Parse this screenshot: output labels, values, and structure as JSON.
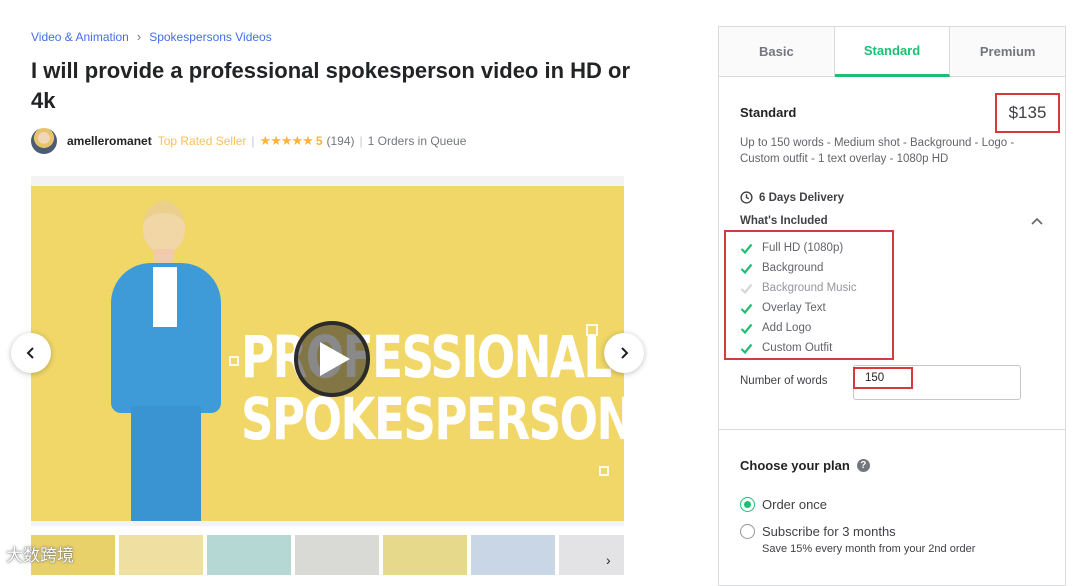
{
  "breadcrumb": {
    "category": "Video & Animation",
    "subcategory": "Spokespersons Videos"
  },
  "gig": {
    "title": "I will provide a professional spokesperson video in HD or 4k"
  },
  "seller": {
    "name": "amelleromanet",
    "level": "Top Rated Seller",
    "rating": "5",
    "reviews": "(194)",
    "queue": "1 Orders in Queue"
  },
  "gallery": {
    "promo_line1": "PROFESSIONAL",
    "promo_line2": "SPOKESPERSON"
  },
  "watermark": "大数跨境",
  "packages": {
    "tabs": [
      "Basic",
      "Standard",
      "Premium"
    ],
    "active_tab": "Standard",
    "name": "Standard",
    "price": "$135",
    "description": "Up to 150 words - Medium shot - Background - Logo - Custom outfit - 1 text overlay - 1080p HD",
    "delivery": "6 Days Delivery",
    "included_title": "What's Included",
    "features": [
      {
        "label": "Full HD (1080p)",
        "included": true
      },
      {
        "label": "Background",
        "included": true
      },
      {
        "label": "Background Music",
        "included": false
      },
      {
        "label": "Overlay Text",
        "included": true
      },
      {
        "label": "Add Logo",
        "included": true
      },
      {
        "label": "Custom Outfit",
        "included": true
      }
    ],
    "words_label": "Number of words",
    "words_value": "150"
  },
  "plan": {
    "title": "Choose your plan",
    "options": [
      {
        "label": "Order once",
        "selected": true
      },
      {
        "label": "Subscribe for 3 months",
        "selected": false
      }
    ],
    "subscribe_note": "Save 15% every month from your 2nd order"
  },
  "colors": {
    "accent_green": "#1dbf73",
    "link_blue": "#446ee7",
    "star": "#ffb33e",
    "highlight_red": "#d73a3a",
    "slide_yellow": "#f0d767"
  }
}
